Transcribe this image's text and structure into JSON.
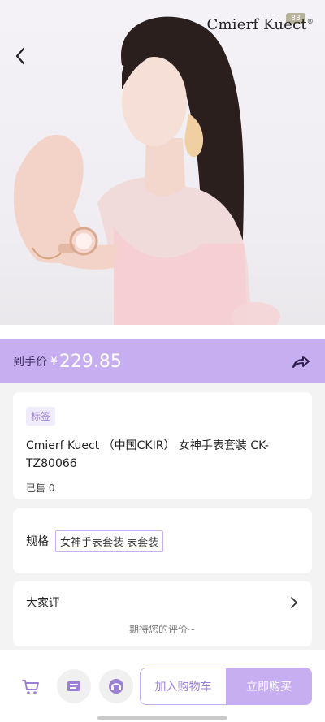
{
  "brand": {
    "name": "Cmierf Kuect",
    "registered": "®",
    "badge": "88"
  },
  "price_bar": {
    "label": "到手价",
    "currency": "¥",
    "value": "229.85"
  },
  "product": {
    "tag": "标签",
    "title": "Cmierf Kuect （中国CKIR） 女神手表套装 CK-TZ80066",
    "sold_label": "已售",
    "sold_count": "0"
  },
  "spec": {
    "label": "规格",
    "selected": "女神手表套装 表套装"
  },
  "reviews": {
    "title": "大家评",
    "empty_text": "期待您的评价~"
  },
  "actions": {
    "add_to_cart": "加入购物车",
    "buy_now": "立即购买"
  },
  "colors": {
    "accent": "#c7aef0",
    "accent_text": "#9a7fd4"
  },
  "icons": {
    "back": "chevron-left-icon",
    "share": "share-arrow-icon",
    "cart": "cart-icon",
    "store": "store-icon",
    "service": "headset-icon",
    "review_more": "chevron-right-icon"
  }
}
